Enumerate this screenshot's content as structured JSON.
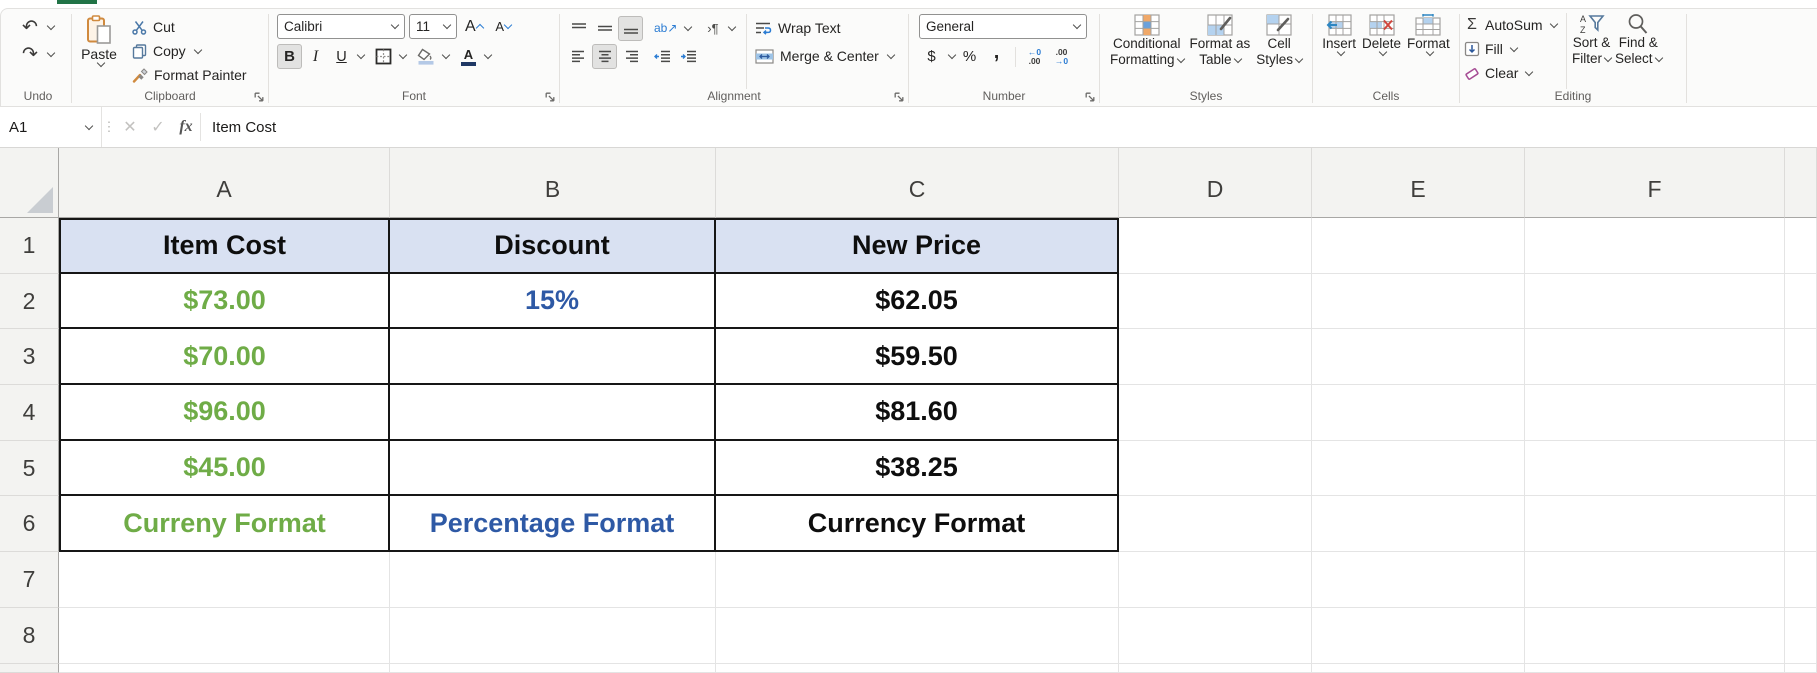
{
  "app": {
    "accent_green": "#217346"
  },
  "ribbon": {
    "undo": {
      "label": "Undo",
      "undo_glyph": "↶",
      "redo_glyph": "↷"
    },
    "clipboard": {
      "label": "Clipboard",
      "paste": "Paste",
      "cut": "Cut",
      "copy": "Copy",
      "format_painter": "Format Painter"
    },
    "font": {
      "label": "Font",
      "family": "Calibri",
      "size": "11",
      "bold": "B",
      "italic": "I",
      "underline": "U",
      "grow": "A",
      "shrink": "A"
    },
    "alignment": {
      "label": "Alignment",
      "wrap": "Wrap Text",
      "merge": "Merge & Center",
      "orientation": "ab↗",
      "direction": "›¶"
    },
    "number": {
      "label": "Number",
      "format": "General",
      "dollar": "$",
      "percent": "%",
      "comma": ",",
      "inc_top": "←0",
      "inc_bot": ".00",
      "dec_top": ".00",
      "dec_bot": "→0"
    },
    "styles": {
      "label": "Styles",
      "cond1": "Conditional",
      "cond2": "Formatting",
      "fat1": "Format as",
      "fat2": "Table",
      "cs1": "Cell",
      "cs2": "Styles"
    },
    "cells": {
      "label": "Cells",
      "insert": "Insert",
      "delete": "Delete",
      "format": "Format"
    },
    "editing": {
      "label": "Editing",
      "sigma": "Σ",
      "autosum": "AutoSum",
      "fill": "Fill",
      "clear": "Clear",
      "sort1": "Sort &",
      "sort2": "Filter",
      "find1": "Find &",
      "find2": "Select",
      "sort_a": "A",
      "sort_z": "Z"
    }
  },
  "formula_bar": {
    "name_box": "A1",
    "cancel_glyph": "✕",
    "enter_glyph": "✓",
    "fx_glyph": "fx",
    "formula": "Item Cost"
  },
  "sheet": {
    "col_headers": [
      "A",
      "B",
      "C",
      "D",
      "E",
      "F"
    ],
    "row_headers": [
      "1",
      "2",
      "3",
      "4",
      "5",
      "6",
      "7",
      "8"
    ],
    "colors": {
      "header_fill": "#D9E1F2",
      "green": "#6FAC47",
      "blue": "#2E59A5"
    },
    "cells": [
      {
        "ref": "A1",
        "text": "Item Cost",
        "fmt": "hd"
      },
      {
        "ref": "B1",
        "text": "Discount",
        "fmt": "hd"
      },
      {
        "ref": "C1",
        "text": "New Price",
        "fmt": "hd"
      },
      {
        "ref": "A2",
        "text": "$73.00",
        "fmt": "green"
      },
      {
        "ref": "B2",
        "text": "15%",
        "fmt": "blue"
      },
      {
        "ref": "C2",
        "text": "$62.05",
        "fmt": "dark"
      },
      {
        "ref": "A3",
        "text": "$70.00",
        "fmt": "green"
      },
      {
        "ref": "B3",
        "text": "",
        "fmt": "empty"
      },
      {
        "ref": "C3",
        "text": "$59.50",
        "fmt": "dark"
      },
      {
        "ref": "A4",
        "text": "$96.00",
        "fmt": "green"
      },
      {
        "ref": "B4",
        "text": "",
        "fmt": "empty"
      },
      {
        "ref": "C4",
        "text": "$81.60",
        "fmt": "dark"
      },
      {
        "ref": "A5",
        "text": "$45.00",
        "fmt": "green"
      },
      {
        "ref": "B5",
        "text": "",
        "fmt": "empty"
      },
      {
        "ref": "C5",
        "text": "$38.25",
        "fmt": "dark"
      },
      {
        "ref": "A6",
        "text": "Curreny Format",
        "fmt": "green"
      },
      {
        "ref": "B6",
        "text": "Percentage Format",
        "fmt": "blue"
      },
      {
        "ref": "C6",
        "text": "Currency Format",
        "fmt": "dark"
      }
    ]
  }
}
